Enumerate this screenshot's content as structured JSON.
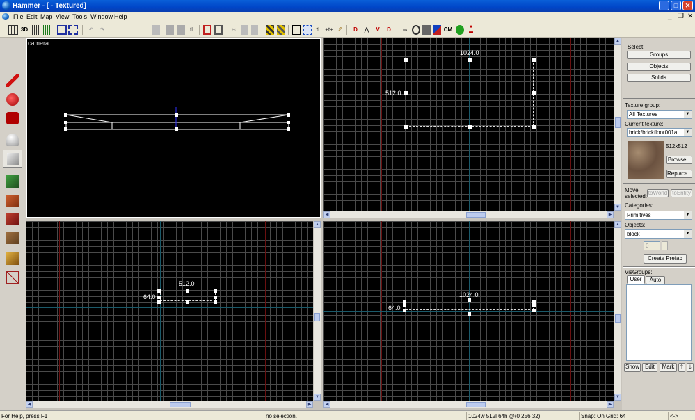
{
  "window": {
    "title": "Hammer - [ - Textured]",
    "min": "_",
    "max": "□",
    "close": "✕"
  },
  "menu": {
    "items": [
      "File",
      "Edit",
      "Map",
      "View",
      "Tools",
      "Window",
      "Help"
    ],
    "mdi_min": "_",
    "mdi_restore": "❐",
    "mdi_close": "✕"
  },
  "toolbar": {
    "cm_label": "CM",
    "tl_label": "tl",
    "tb_3d": "3D"
  },
  "viewports": {
    "camera": {
      "label": "camera"
    },
    "top": {
      "width_label": "1024.0",
      "height_label": "512.0"
    },
    "front": {
      "width_label": "512.0",
      "height_label": "64.0"
    },
    "side": {
      "width_label": "1024.0",
      "height_label": "64.0"
    }
  },
  "panel": {
    "select_label": "Select:",
    "groups": "Groups",
    "objects": "Objects",
    "solids": "Solids",
    "texture_group_label": "Texture group:",
    "texture_group_value": "All Textures",
    "current_texture_label": "Current texture:",
    "current_texture_value": "brick/brickfloor001a",
    "texture_size": "512x512",
    "browse": "Browse...",
    "replace": "Replace...",
    "move_selected_label": "Move selected:",
    "to_world": "toWorld",
    "to_entity": "toEntity",
    "categories_label": "Categories:",
    "categories_value": "Primitives",
    "objects_label": "Objects:",
    "objects_value": "block",
    "sides_value": "0",
    "create_prefab": "Create Prefab",
    "visgroups_label": "VisGroups:",
    "tab_user": "User",
    "tab_auto": "Auto",
    "show": "Show",
    "edit": "Edit",
    "mark": "Mark",
    "up": "🡑",
    "down": "🡓"
  },
  "status": {
    "help": "For Help, press F1",
    "selection": "no selection.",
    "dims": "1024w 512l 64h @(0 256 32)",
    "snap": "Snap: On Grid: 64",
    "arrows": "<->"
  },
  "colors": {
    "titlebar": "#0046c8",
    "grid": "#4a4a4a",
    "axis_red": "#7a1010",
    "axis_teal": "#106070"
  }
}
